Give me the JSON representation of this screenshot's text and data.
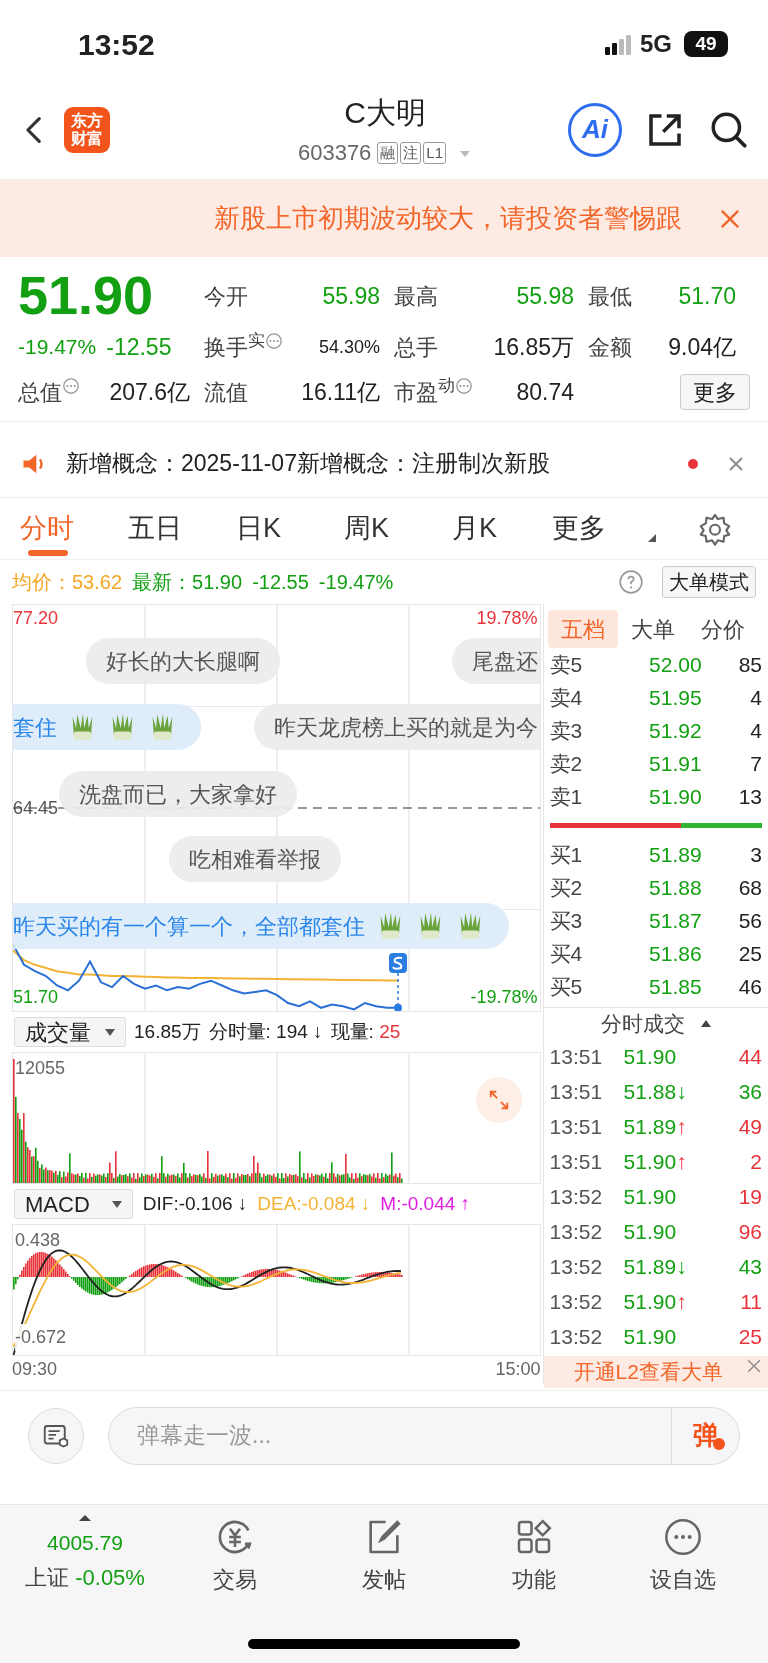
{
  "status_bar": {
    "time": "13:52",
    "network": "5G",
    "battery": "49"
  },
  "header": {
    "logo_lines": [
      "东方",
      "财富"
    ],
    "title": "C大明",
    "code": "603376",
    "badges": [
      "融",
      "注",
      "L1"
    ],
    "ai_label": "Ai"
  },
  "warning": {
    "text": "新股上市初期波动较大，请投资者警惕跟"
  },
  "quote": {
    "price": "51.90",
    "change_pct": "-19.47%",
    "change": "-12.55",
    "color": "#12a012",
    "stats": [
      {
        "label": "今开",
        "value": "55.98",
        "color": "#12a012",
        "info": false
      },
      {
        "label": "最高",
        "value": "55.98",
        "color": "#12a012",
        "info": false
      },
      {
        "label": "最低",
        "value": "51.70",
        "color": "#12a012",
        "info": false
      },
      {
        "label": "换手$^{实}$",
        "value": "54.30%",
        "color": "#222222",
        "info": true
      },
      {
        "label": "总手",
        "value": "16.85万",
        "color": "#222222",
        "info": false
      },
      {
        "label": "金额",
        "value": "9.04亿",
        "color": "#222222",
        "info": false
      },
      {
        "label": "总值",
        "value": "207.6亿",
        "color": "#222222",
        "info": true
      },
      {
        "label": "流值",
        "value": "16.11亿",
        "color": "#222222",
        "info": false
      },
      {
        "label": "市盈$^{动}$",
        "value": "80.74",
        "color": "#222222",
        "info": true
      }
    ],
    "more_button": "更多"
  },
  "notice": {
    "text": "新增概念：2025-11-07新增概念：注册制次新股",
    "unread": true
  },
  "tabs": [
    {
      "label": "分时",
      "selected": true
    },
    {
      "label": "五日",
      "selected": false
    },
    {
      "label": "日K",
      "selected": false
    },
    {
      "label": "周K",
      "selected": false
    },
    {
      "label": "月K",
      "selected": false
    },
    {
      "label": "更多",
      "selected": false
    }
  ],
  "price_line": {
    "avg_label": "均价：",
    "avg": "53.62",
    "latest_label": "最新：",
    "latest": "51.90",
    "change": "-12.55",
    "change_pct": "-19.47%",
    "mode_button": "大单模式"
  },
  "chart": {
    "top_price": "77.20",
    "top_pct": "19.78%",
    "prev_close": "64.45",
    "bottom_price": "51.70",
    "bottom_pct": "-19.78%",
    "time_start": "09:30",
    "time_end": "15:00",
    "danmaku": [
      {
        "text": "好长的大长腿啊",
        "kind": "normal",
        "leeks": false
      },
      {
        "text": "尾盘还",
        "kind": "normal",
        "leeks": false
      },
      {
        "text": "套住",
        "kind": "mine",
        "leeks": true
      },
      {
        "text": "昨天龙虎榜上买的就是为今",
        "kind": "normal",
        "leeks": false
      },
      {
        "text": "洗盘而已，大家拿好",
        "kind": "normal",
        "leeks": false
      },
      {
        "text": "吃相难看举报",
        "kind": "normal",
        "leeks": false
      },
      {
        "text": "昨天买的有一个算一个，全部都套住",
        "kind": "mine",
        "leeks": true
      }
    ]
  },
  "volume": {
    "selector": "成交量",
    "total": "16.85万",
    "minute_label": "分时量:",
    "minute": "194",
    "minute_arrow": "↓",
    "now_label": "现量:",
    "now": "25",
    "max_label": "12055"
  },
  "macd": {
    "selector": "MACD",
    "dif": "DIF:-0.106 ↓",
    "dea": "DEA:-0.084 ↓",
    "m": "M:-0.044 ↑",
    "top_label": "0.438",
    "bottom_label": "-0.672"
  },
  "order_book": {
    "tabs": [
      {
        "label": "五档",
        "selected": true
      },
      {
        "label": "大单",
        "selected": false
      },
      {
        "label": "分价",
        "selected": false
      }
    ],
    "asks": [
      {
        "label": "卖5",
        "price": "52.00",
        "volume": "85"
      },
      {
        "label": "卖4",
        "price": "51.95",
        "volume": "4"
      },
      {
        "label": "卖3",
        "price": "51.92",
        "volume": "4"
      },
      {
        "label": "卖2",
        "price": "51.91",
        "volume": "7"
      },
      {
        "label": "卖1",
        "price": "51.90",
        "volume": "13"
      }
    ],
    "ratio_bar": {
      "level": 0.62
    },
    "bids": [
      {
        "label": "买1",
        "price": "51.89",
        "volume": "3"
      },
      {
        "label": "买2",
        "price": "51.88",
        "volume": "68"
      },
      {
        "label": "买3",
        "price": "51.87",
        "volume": "56"
      },
      {
        "label": "买4",
        "price": "51.86",
        "volume": "25"
      },
      {
        "label": "买5",
        "price": "51.85",
        "volume": "46"
      }
    ]
  },
  "trades": {
    "title": "分时成交",
    "rows": [
      {
        "time": "13:51",
        "price": "51.90",
        "volume": "44",
        "color": "#e8333a"
      },
      {
        "time": "13:51",
        "price": "51.88",
        "arrow": "↓",
        "volume": "36",
        "color": "#12a012"
      },
      {
        "time": "13:51",
        "price": "51.89",
        "arrow": "↑",
        "volume": "49",
        "color": "#e8333a"
      },
      {
        "time": "13:51",
        "price": "51.90",
        "arrow": "↑",
        "volume": "2",
        "color": "#e8333a"
      },
      {
        "time": "13:52",
        "price": "51.90",
        "volume": "19",
        "color": "#e8333a"
      },
      {
        "time": "13:52",
        "price": "51.90",
        "volume": "96",
        "color": "#e8333a"
      },
      {
        "time": "13:52",
        "price": "51.89",
        "arrow": "↓",
        "volume": "43",
        "color": "#12a012"
      },
      {
        "time": "13:52",
        "price": "51.90",
        "arrow": "↑",
        "volume": "11",
        "color": "#e8333a"
      },
      {
        "time": "13:52",
        "price": "51.90",
        "volume": "25",
        "color": "#e8333a"
      }
    ],
    "l2_banner": "开通L2查看大单"
  },
  "comment_bar": {
    "placeholder": "弹幕走一波...",
    "send_label": "弹"
  },
  "bottom_nav": {
    "index_value": "4005.79",
    "index_name": "上证",
    "index_change": "-0.05%",
    "items": [
      {
        "label": "交易",
        "kind": "trade"
      },
      {
        "label": "发帖",
        "kind": "post"
      },
      {
        "label": "功能",
        "kind": "apps"
      },
      {
        "label": "设自选",
        "kind": "more"
      }
    ]
  }
}
